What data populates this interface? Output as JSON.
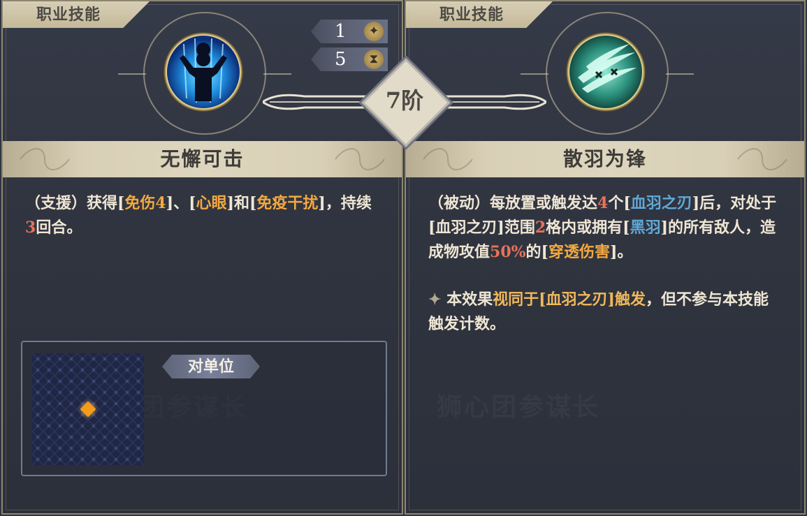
{
  "left": {
    "tab_label": "职业技能",
    "skill_icon": "arms-raised-figure-icon",
    "skill_name": "无懈可击",
    "desc": [
      {
        "t": "（支援）获得[",
        "c": ""
      },
      {
        "t": "免伤4",
        "c": "hl-orange"
      },
      {
        "t": "]、[",
        "c": ""
      },
      {
        "t": "心眼",
        "c": "hl-orange"
      },
      {
        "t": "]和[",
        "c": ""
      },
      {
        "t": "免疫干扰",
        "c": "hl-orange"
      },
      {
        "t": "]，持续",
        "c": ""
      },
      {
        "t": "3",
        "c": "hl-red"
      },
      {
        "t": "回合。",
        "c": ""
      }
    ],
    "cost_value": "1",
    "cost_icon": "star-sparkle-icon",
    "cooldown_value": "5",
    "cooldown_icon": "hourglass-icon",
    "target_label": "对单位",
    "watermark": "团参谋长"
  },
  "tier_label": "7阶",
  "right": {
    "tab_label": "职业技能",
    "skill_icon": "feather-blades-icon",
    "skill_name": "散羽为锋",
    "desc": [
      {
        "t": "（被动）每放置或触发达",
        "c": ""
      },
      {
        "t": "4",
        "c": "hl-red"
      },
      {
        "t": "个[",
        "c": ""
      },
      {
        "t": "血羽之刃",
        "c": "hl-blue"
      },
      {
        "t": "]后，对处于[血羽之刃]范围",
        "c": ""
      },
      {
        "t": "2",
        "c": "hl-red"
      },
      {
        "t": "格内或拥有[",
        "c": ""
      },
      {
        "t": "黑羽",
        "c": "hl-blue"
      },
      {
        "t": "]的所有敌人，造成物攻值",
        "c": ""
      },
      {
        "t": "50%",
        "c": "hl-red"
      },
      {
        "t": "的[",
        "c": ""
      },
      {
        "t": "穿透伤害",
        "c": "hl-orange"
      },
      {
        "t": "]。",
        "c": ""
      }
    ],
    "note_icon": "four-point-star-icon",
    "note": [
      {
        "t": "本效果",
        "c": ""
      },
      {
        "t": "视同于[血羽之刃]触发",
        "c": "hl-gold"
      },
      {
        "t": "，但不参与本技能触发计数。",
        "c": ""
      }
    ],
    "watermark": "狮心团参谋长"
  },
  "colors": {
    "panel_bg": "#2f3442",
    "banner": "#d8cfb6",
    "accent_orange": "#f3a941",
    "accent_red": "#e8735a",
    "accent_blue": "#5fa9d7",
    "marker": "#f59c1a"
  }
}
